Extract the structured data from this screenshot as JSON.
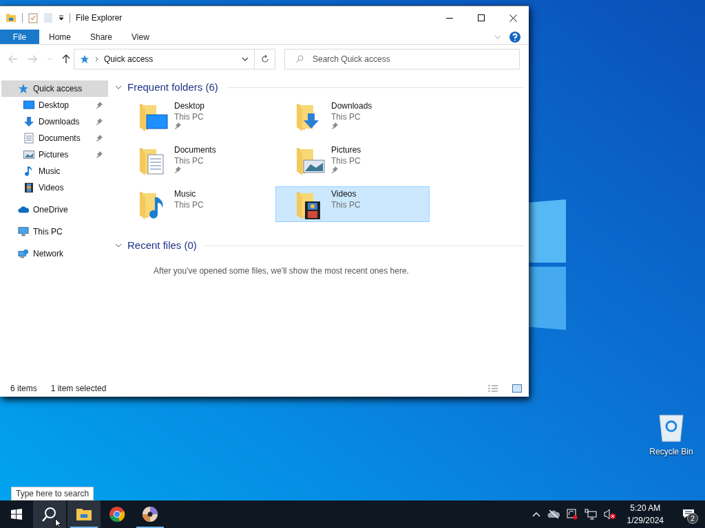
{
  "window": {
    "title": "File Explorer"
  },
  "ribbon": {
    "tabs": [
      {
        "label": "File",
        "kind": "menu"
      },
      {
        "label": "Home",
        "kind": "tab"
      },
      {
        "label": "Share",
        "kind": "tab"
      },
      {
        "label": "View",
        "kind": "tab"
      }
    ]
  },
  "address_bar": {
    "path": "Quick access"
  },
  "search": {
    "placeholder": "Search Quick access"
  },
  "navigation": [
    {
      "label": "Quick access",
      "selected": true,
      "children": [
        {
          "label": "Desktop",
          "pinned": true,
          "selected": false
        },
        {
          "label": "Downloads",
          "pinned": true,
          "selected": false
        },
        {
          "label": "Documents",
          "pinned": true,
          "selected": false
        },
        {
          "label": "Pictures",
          "pinned": true,
          "selected": false
        },
        {
          "label": "Music",
          "pinned": false,
          "selected": false
        },
        {
          "label": "Videos",
          "pinned": false,
          "selected": false
        }
      ]
    },
    {
      "label": "OneDrive",
      "selected": false
    },
    {
      "label": "This PC",
      "selected": false
    },
    {
      "label": "Network",
      "selected": false
    }
  ],
  "sections": [
    {
      "title": "Frequent folders (6)",
      "expanded": true,
      "folders": [
        {
          "name": "Desktop",
          "location": "This PC",
          "pinned": true,
          "selected": false
        },
        {
          "name": "Downloads",
          "location": "This PC",
          "pinned": true,
          "selected": false
        },
        {
          "name": "Documents",
          "location": "This PC",
          "pinned": true,
          "selected": false
        },
        {
          "name": "Pictures",
          "location": "This PC",
          "pinned": true,
          "selected": false
        },
        {
          "name": "Music",
          "location": "This PC",
          "pinned": false,
          "selected": false
        },
        {
          "name": "Videos",
          "location": "This PC",
          "pinned": false,
          "selected": true
        }
      ]
    },
    {
      "title": "Recent files (0)",
      "expanded": true,
      "message": "After you've opened some files, we'll show the most recent ones here."
    }
  ],
  "status_bar": {
    "item_count": "6 items",
    "selection": "1 item selected"
  },
  "desktop_icons": [
    {
      "label": "Recycle Bin"
    }
  ],
  "taskbar": {
    "tooltip": "Type here to search",
    "buttons": [
      {
        "highlighted": false,
        "running": false
      },
      {
        "highlighted": true,
        "running": false
      },
      {
        "highlighted": true,
        "running": true
      },
      {
        "highlighted": false,
        "running": false
      },
      {
        "highlighted": false,
        "running": true
      }
    ],
    "clock": {
      "time": "5:20 AM",
      "date": "1/29/2024"
    },
    "notification_count": "2"
  }
}
